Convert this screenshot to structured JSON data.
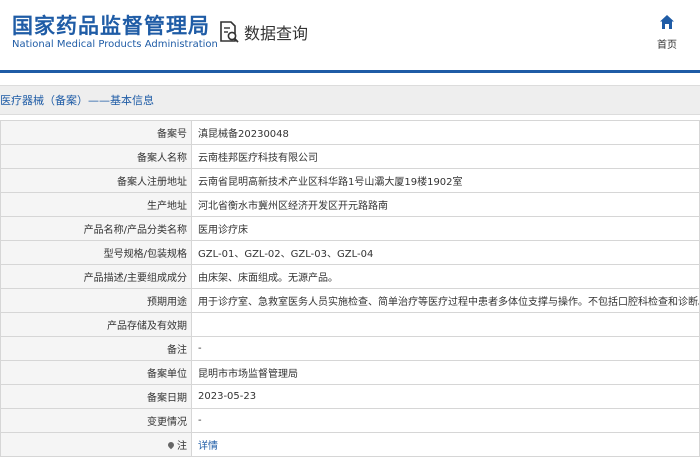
{
  "header": {
    "logo_cn": "国家药品监督管理局",
    "logo_en": "National Medical Products Administration",
    "query_label": "数据查询",
    "home_label": "首页"
  },
  "section": {
    "title": "医疗器械（备案）——基本信息"
  },
  "record": {
    "rows": [
      {
        "label": "备案号",
        "value": "滇昆械备20230048"
      },
      {
        "label": "备案人名称",
        "value": "云南桂邦医疗科技有限公司"
      },
      {
        "label": "备案人注册地址",
        "value": "云南省昆明高新技术产业区科华路1号山灞大厦19楼1902室"
      },
      {
        "label": "生产地址",
        "value": "河北省衡水市冀州区经济开发区开元路路南"
      },
      {
        "label": "产品名称/产品分类名称",
        "value": "医用诊疗床"
      },
      {
        "label": "型号规格/包装规格",
        "value": "GZL-01、GZL-02、GZL-03、GZL-04"
      },
      {
        "label": "产品描述/主要组成成分",
        "value": "由床架、床面组成。无源产品。"
      },
      {
        "label": "预期用途",
        "value": "用于诊疗室、急救室医务人员实施检查、简单治疗等医疗过程中患者多体位支撑与操作。不包括口腔科检查和诊断。"
      },
      {
        "label": "产品存储及有效期",
        "value": ""
      },
      {
        "label": "备注",
        "value": "-"
      },
      {
        "label": "备案单位",
        "value": "昆明市市场监督管理局"
      },
      {
        "label": "备案日期",
        "value": "2023-05-23"
      },
      {
        "label": "变更情况",
        "value": "-"
      },
      {
        "label": "注",
        "value": "详情"
      }
    ]
  },
  "colors": {
    "brand": "#1f5ca6",
    "label_bg": "#f5f5f5",
    "border": "#d6d6d6"
  },
  "icons": {
    "query": "document-search-icon",
    "home": "home-icon",
    "note": "pin-icon"
  }
}
